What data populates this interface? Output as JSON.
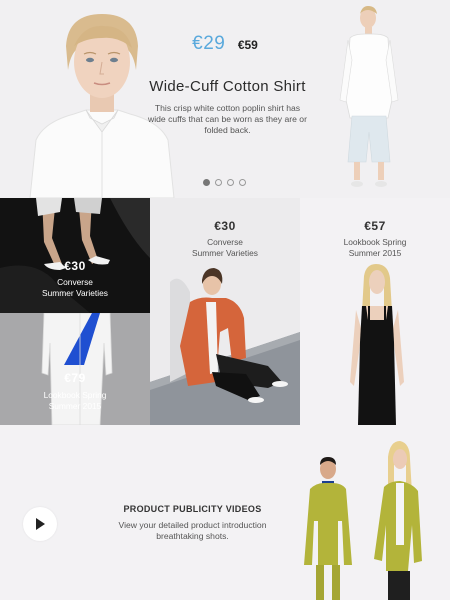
{
  "hero": {
    "price_new": "€29",
    "price_old": "€59",
    "title": "Wide-Cuff Cotton Shirt",
    "description": "This crisp white cotton poplin shirt has wide cuffs that can be worn as they are or folded back.",
    "slides": 4,
    "active_slide": 1
  },
  "tiles": [
    {
      "price": "€30",
      "caption_line1": "Converse",
      "caption_line2": "Summer Varieties"
    },
    {
      "price": "€79",
      "caption_line1": "Lookbook Spring",
      "caption_line2": "Summer 2015"
    },
    {
      "price": "€30",
      "caption_line1": "Converse",
      "caption_line2": "Summer Varieties"
    },
    {
      "price": "€57",
      "caption_line1": "Lookbook Spring",
      "caption_line2": "Summer 2015"
    }
  ],
  "video": {
    "title": "PRODUCT PUBLICITY VIDEOS",
    "description_line1": "View your detailed product introduction",
    "description_line2": "breathtaking shots."
  },
  "colors": {
    "accent_price": "#5aa9dc",
    "background": "#f3f2f4",
    "orange_jacket": "#d5653b",
    "lime_coat": "#b3b43a",
    "blue_accent": "#1f4fd1"
  },
  "icons": {
    "play": "play-icon"
  }
}
